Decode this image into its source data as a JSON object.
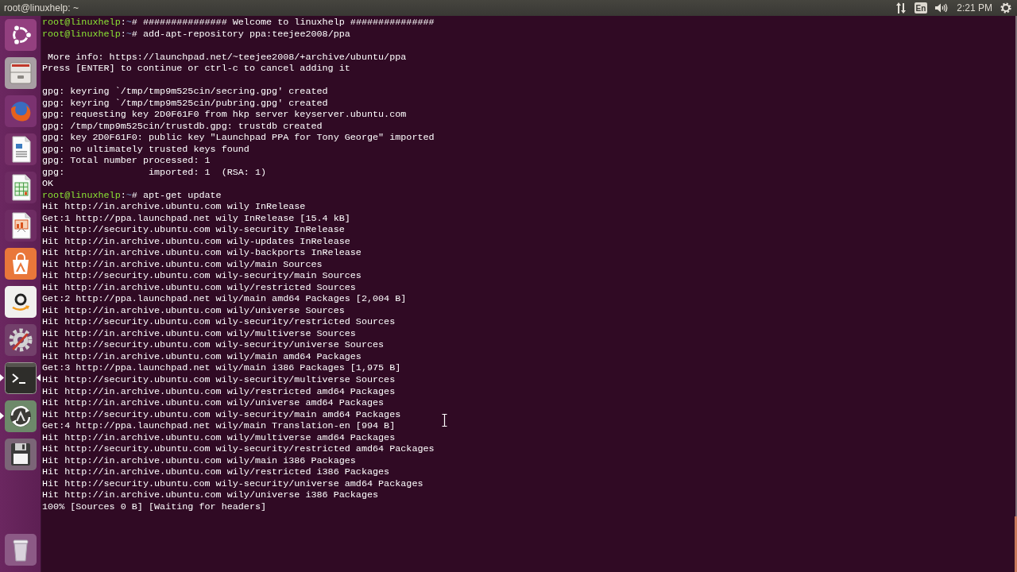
{
  "top_panel": {
    "title": "root@linuxhelp: ~",
    "keyboard_layout": "En",
    "clock": "2:21 PM"
  },
  "launcher": {
    "items": [
      {
        "kind": "dash",
        "running": false,
        "focused": false
      },
      {
        "kind": "files",
        "running": false,
        "focused": false
      },
      {
        "kind": "browser",
        "running": false,
        "focused": false
      },
      {
        "kind": "writer",
        "running": false,
        "focused": false
      },
      {
        "kind": "calc",
        "running": false,
        "focused": false
      },
      {
        "kind": "impress",
        "running": false,
        "focused": false
      },
      {
        "kind": "store",
        "running": false,
        "focused": false
      },
      {
        "kind": "shop",
        "running": false,
        "focused": false
      },
      {
        "kind": "settings",
        "running": false,
        "focused": false
      },
      {
        "kind": "terminal",
        "running": true,
        "focused": true
      },
      {
        "kind": "updater",
        "running": true,
        "focused": false
      },
      {
        "kind": "disk",
        "running": false,
        "focused": false
      },
      {
        "kind": "trash",
        "running": false,
        "focused": false
      }
    ]
  },
  "terminal": {
    "lines": [
      {
        "kind": "prompt",
        "user_host": "root@linuxhelp",
        "separator": ":",
        "path": "~",
        "symbol": "#",
        "command": "############### Welcome to linuxhelp ###############"
      },
      {
        "kind": "prompt",
        "user_host": "root@linuxhelp",
        "separator": ":",
        "path": "~",
        "symbol": "#",
        "command": "add-apt-repository ppa:teejee2008/ppa"
      },
      {
        "kind": "blank"
      },
      {
        "kind": "output",
        "text": " More info: https://launchpad.net/~teejee2008/+archive/ubuntu/ppa"
      },
      {
        "kind": "output",
        "text": "Press [ENTER] to continue or ctrl-c to cancel adding it"
      },
      {
        "kind": "blank"
      },
      {
        "kind": "output",
        "text": "gpg: keyring `/tmp/tmp9m525cin/secring.gpg' created"
      },
      {
        "kind": "output",
        "text": "gpg: keyring `/tmp/tmp9m525cin/pubring.gpg' created"
      },
      {
        "kind": "output",
        "text": "gpg: requesting key 2D0F61F0 from hkp server keyserver.ubuntu.com"
      },
      {
        "kind": "output",
        "text": "gpg: /tmp/tmp9m525cin/trustdb.gpg: trustdb created"
      },
      {
        "kind": "output",
        "text": "gpg: key 2D0F61F0: public key \"Launchpad PPA for Tony George\" imported"
      },
      {
        "kind": "output",
        "text": "gpg: no ultimately trusted keys found"
      },
      {
        "kind": "output",
        "text": "gpg: Total number processed: 1"
      },
      {
        "kind": "output",
        "text": "gpg:               imported: 1  (RSA: 1)"
      },
      {
        "kind": "output",
        "text": "OK"
      },
      {
        "kind": "prompt",
        "user_host": "root@linuxhelp",
        "separator": ":",
        "path": "~",
        "symbol": "#",
        "command": "apt-get update"
      },
      {
        "kind": "output",
        "text": "Hit http://in.archive.ubuntu.com wily InRelease"
      },
      {
        "kind": "output",
        "text": "Get:1 http://ppa.launchpad.net wily InRelease [15.4 kB]"
      },
      {
        "kind": "output",
        "text": "Hit http://security.ubuntu.com wily-security InRelease"
      },
      {
        "kind": "output",
        "text": "Hit http://in.archive.ubuntu.com wily-updates InRelease"
      },
      {
        "kind": "output",
        "text": "Hit http://in.archive.ubuntu.com wily-backports InRelease"
      },
      {
        "kind": "output",
        "text": "Hit http://in.archive.ubuntu.com wily/main Sources"
      },
      {
        "kind": "output",
        "text": "Hit http://security.ubuntu.com wily-security/main Sources"
      },
      {
        "kind": "output",
        "text": "Hit http://in.archive.ubuntu.com wily/restricted Sources"
      },
      {
        "kind": "output",
        "text": "Get:2 http://ppa.launchpad.net wily/main amd64 Packages [2,004 B]"
      },
      {
        "kind": "output",
        "text": "Hit http://in.archive.ubuntu.com wily/universe Sources"
      },
      {
        "kind": "output",
        "text": "Hit http://security.ubuntu.com wily-security/restricted Sources"
      },
      {
        "kind": "output",
        "text": "Hit http://in.archive.ubuntu.com wily/multiverse Sources"
      },
      {
        "kind": "output",
        "text": "Hit http://security.ubuntu.com wily-security/universe Sources"
      },
      {
        "kind": "output",
        "text": "Hit http://in.archive.ubuntu.com wily/main amd64 Packages"
      },
      {
        "kind": "output",
        "text": "Get:3 http://ppa.launchpad.net wily/main i386 Packages [1,975 B]"
      },
      {
        "kind": "output",
        "text": "Hit http://security.ubuntu.com wily-security/multiverse Sources"
      },
      {
        "kind": "output",
        "text": "Hit http://in.archive.ubuntu.com wily/restricted amd64 Packages"
      },
      {
        "kind": "output",
        "text": "Hit http://in.archive.ubuntu.com wily/universe amd64 Packages"
      },
      {
        "kind": "output",
        "text": "Hit http://security.ubuntu.com wily-security/main amd64 Packages"
      },
      {
        "kind": "output",
        "text": "Get:4 http://ppa.launchpad.net wily/main Translation-en [994 B]"
      },
      {
        "kind": "output",
        "text": "Hit http://in.archive.ubuntu.com wily/multiverse amd64 Packages"
      },
      {
        "kind": "output",
        "text": "Hit http://security.ubuntu.com wily-security/restricted amd64 Packages"
      },
      {
        "kind": "output",
        "text": "Hit http://in.archive.ubuntu.com wily/main i386 Packages"
      },
      {
        "kind": "output",
        "text": "Hit http://in.archive.ubuntu.com wily/restricted i386 Packages"
      },
      {
        "kind": "output",
        "text": "Hit http://security.ubuntu.com wily-security/universe amd64 Packages"
      },
      {
        "kind": "output",
        "text": "Hit http://in.archive.ubuntu.com wily/universe i386 Packages"
      },
      {
        "kind": "output",
        "text": "100% [Sources 0 B] [Waiting for headers]"
      }
    ]
  }
}
